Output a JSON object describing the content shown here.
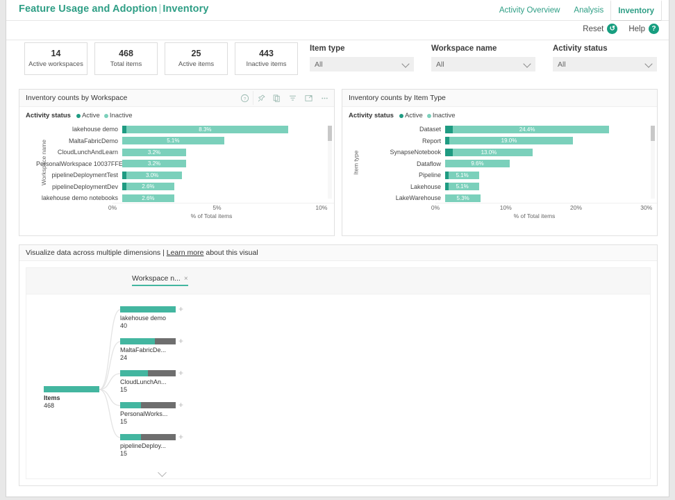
{
  "header": {
    "title_main": "Feature Usage and Adoption",
    "title_sep": "|",
    "title_page": "Inventory",
    "nav": [
      {
        "label": "Activity Overview",
        "active": false
      },
      {
        "label": "Analysis",
        "active": false
      },
      {
        "label": "Inventory",
        "active": true
      }
    ]
  },
  "actionbar": {
    "reset_label": "Reset",
    "reset_icon": "reset-circle-icon",
    "reset_glyph": "↺",
    "help_label": "Help",
    "help_icon": "help-circle-icon",
    "help_glyph": "?"
  },
  "kpis": [
    {
      "value": "14",
      "label": "Active workspaces"
    },
    {
      "value": "468",
      "label": "Total items"
    },
    {
      "value": "25",
      "label": "Active items"
    },
    {
      "value": "443",
      "label": "Inactive items"
    }
  ],
  "slicers": [
    {
      "label": "Item type",
      "value": "All",
      "placeholder": "All"
    },
    {
      "label": "Workspace name",
      "value": "All",
      "placeholder": "All"
    },
    {
      "label": "Activity status",
      "value": "All",
      "placeholder": "All"
    }
  ],
  "visual_icons": [
    {
      "name": "info-icon",
      "glyph": "?"
    },
    {
      "name": "pin-icon",
      "glyph": "pin"
    },
    {
      "name": "copy-icon",
      "glyph": "copy"
    },
    {
      "name": "filter-icon",
      "glyph": "filter"
    },
    {
      "name": "focus-icon",
      "glyph": "focus"
    },
    {
      "name": "more-options-icon",
      "glyph": "..."
    }
  ],
  "colors": {
    "brand_teal": "#2e9e85",
    "active_green": "#1f9b82",
    "inactive_teal": "#7bd0bb",
    "tree_bar_teal": "#43b6a0",
    "tree_bar_grey": "#6e6e6e"
  },
  "legend": {
    "title": "Activity status",
    "items": [
      {
        "label": "Active",
        "color": "#1f9b82"
      },
      {
        "label": "Inactive",
        "color": "#7bd0bb"
      }
    ]
  },
  "chart_data": [
    {
      "type": "bar",
      "orientation": "horizontal",
      "stacked": true,
      "title": "Inventory counts by Workspace",
      "xlabel": "% of Total items",
      "ylabel": "Workspace name",
      "xlim": [
        0,
        10.6
      ],
      "xticks": [
        "0%",
        "5%",
        "10%"
      ],
      "xtick_values": [
        0,
        5,
        10
      ],
      "grid": false,
      "legend": [
        "Active",
        "Inactive"
      ],
      "legend_position": "top-left",
      "categories": [
        "lakehouse demo",
        "MaltaFabricDemo",
        "CloudLunchAndLearn",
        "PersonalWorkspace 10037FFE...",
        "pipelineDeploymentTest",
        "pipelineDeploymentDev",
        "lakehouse demo notebooks"
      ],
      "series": [
        {
          "name": "Active",
          "values": [
            0.21,
            0.0,
            0.0,
            0.0,
            0.21,
            0.21,
            0.0
          ]
        },
        {
          "name": "Inactive",
          "values": [
            8.09,
            5.1,
            3.2,
            3.2,
            2.79,
            2.39,
            2.6
          ]
        }
      ],
      "totals": [
        8.3,
        5.1,
        3.2,
        3.2,
        3.0,
        2.6,
        2.6
      ],
      "data_labels": [
        "8.3%",
        "5.1%",
        "3.2%",
        "3.2%",
        "3.0%",
        "2.6%",
        "2.6%"
      ]
    },
    {
      "type": "bar",
      "orientation": "horizontal",
      "stacked": true,
      "title": "Inventory counts by Item Type",
      "xlabel": "% of Total items",
      "ylabel": "Item type",
      "xlim": [
        0,
        31.5
      ],
      "xticks": [
        "0%",
        "10%",
        "20%",
        "30%"
      ],
      "xtick_values": [
        0,
        10,
        20,
        30
      ],
      "grid": false,
      "legend": [
        "Active",
        "Inactive"
      ],
      "legend_position": "top-left",
      "categories": [
        "Dataset",
        "Report",
        "SynapseNotebook",
        "Dataflow",
        "Pipeline",
        "Lakehouse",
        "LakeWarehouse"
      ],
      "series": [
        {
          "name": "Active",
          "values": [
            1.1,
            0.6,
            1.1,
            0.0,
            0.5,
            0.5,
            0.0
          ]
        },
        {
          "name": "Inactive",
          "values": [
            23.3,
            18.4,
            11.9,
            9.6,
            4.6,
            4.6,
            5.3
          ]
        }
      ],
      "totals": [
        24.4,
        19.0,
        13.0,
        9.6,
        5.1,
        5.1,
        5.3
      ],
      "data_labels": [
        "24.4%",
        "19.0%",
        "13.0%",
        "9.6%",
        "5.1%",
        "5.1%",
        "5.3%"
      ]
    }
  ],
  "tree": {
    "header_text_before": "Visualize data across multiple dimensions |",
    "header_link": "Learn more",
    "header_text_after": "about this visual",
    "chip": {
      "label": "Workspace n...",
      "close_glyph": "×"
    },
    "root": {
      "name": "Items",
      "value": "468",
      "fill_pct": 100
    },
    "nodes": [
      {
        "name": "lakehouse demo",
        "value": "40",
        "fill_pct": 100,
        "expand_glyph": "+"
      },
      {
        "name": "MaltaFabricDe...",
        "value": "24",
        "fill_pct": 62,
        "expand_glyph": "+"
      },
      {
        "name": "CloudLunchAn...",
        "value": "15",
        "fill_pct": 50,
        "expand_glyph": "+"
      },
      {
        "name": "PersonalWorks...",
        "value": "15",
        "fill_pct": 38,
        "expand_glyph": "+"
      },
      {
        "name": "pipelineDeploy...",
        "value": "15",
        "fill_pct": 38,
        "expand_glyph": "+"
      }
    ],
    "more_icon": "chevron-down-icon"
  }
}
